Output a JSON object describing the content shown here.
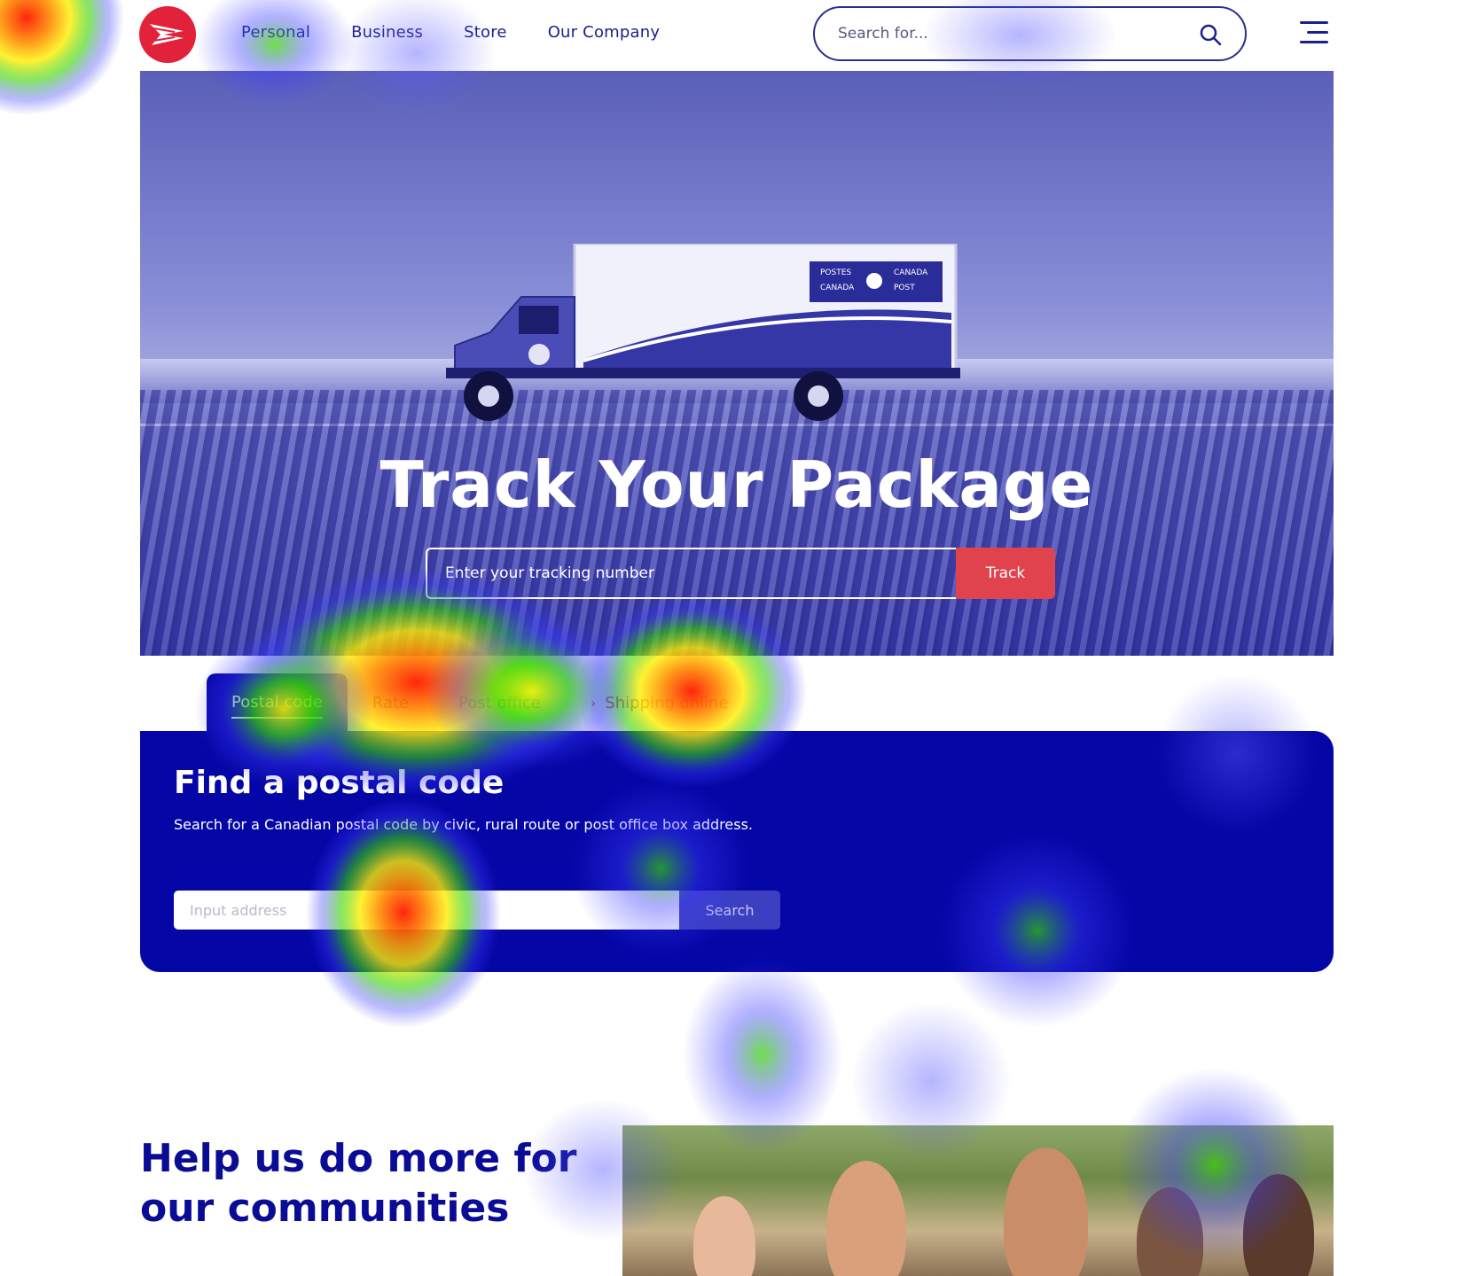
{
  "header": {
    "logo_name": "canada-post-logo",
    "nav": [
      "Personal",
      "Business",
      "Store",
      "Our Company"
    ],
    "search_placeholder": "Search for...",
    "search_icon": "search-icon",
    "menu_icon": "hamburger-menu-icon"
  },
  "hero": {
    "title": "Track Your Package",
    "tracking_placeholder": "Enter your tracking number",
    "track_button": "Track",
    "truck_sign": [
      "POSTES",
      "CANADA",
      "CANADA",
      "POST"
    ]
  },
  "tabs": [
    {
      "label": "Postal code",
      "active": true
    },
    {
      "label": "Rate",
      "active": false
    },
    {
      "label": "Post office",
      "active": false
    },
    {
      "label": "Shipping online",
      "active": false,
      "icon": "chevron-right-icon"
    }
  ],
  "postal_panel": {
    "title": "Find a postal code",
    "description": "Search for a Canadian postal code by civic, rural route or post office box address.",
    "input_placeholder": "Input address",
    "search_button": "Search"
  },
  "community": {
    "title": "Help us do more for our communities"
  },
  "colors": {
    "brand_red": "#e2213a",
    "brand_blue": "#0506a6",
    "nav_text": "#1b1f8c",
    "track_button": "#e0434d"
  }
}
